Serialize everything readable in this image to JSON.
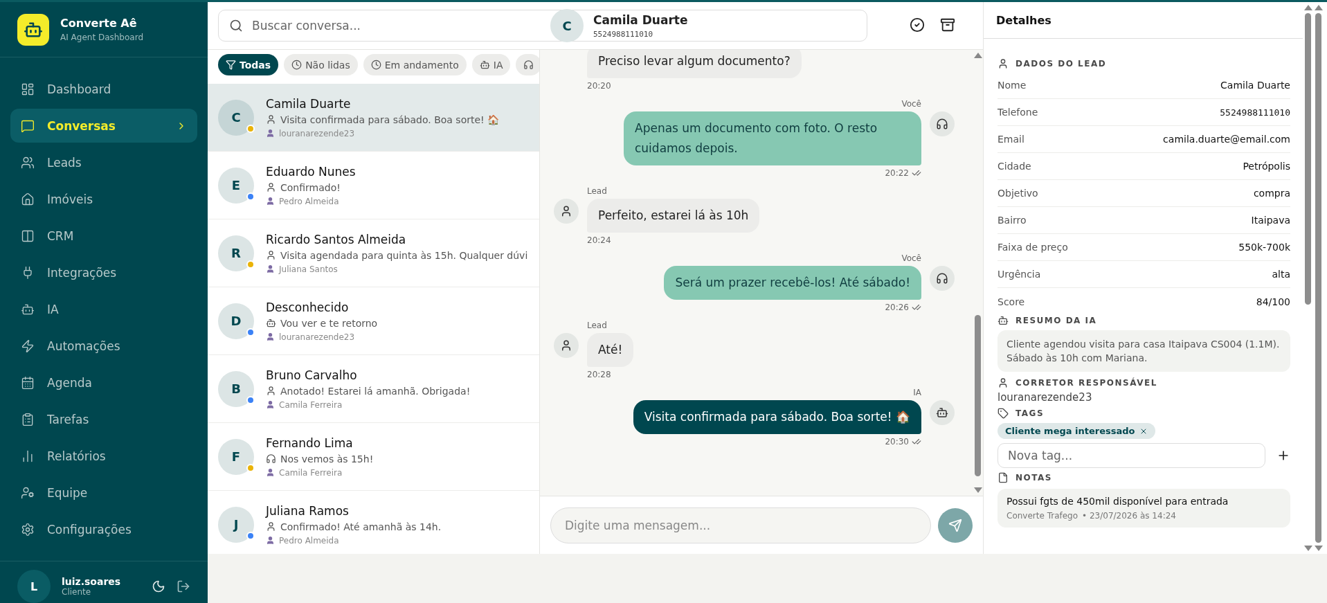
{
  "brand": {
    "name": "Converte Aê",
    "subtitle": "AI Agent Dashboard"
  },
  "nav": [
    {
      "label": "Dashboard",
      "selected": false
    },
    {
      "label": "Conversas",
      "selected": true
    },
    {
      "label": "Leads",
      "selected": false
    },
    {
      "label": "Imóveis",
      "selected": false
    },
    {
      "label": "CRM",
      "selected": false
    },
    {
      "label": "Integrações",
      "selected": false
    },
    {
      "label": "IA",
      "selected": false
    },
    {
      "label": "Automações",
      "selected": false
    },
    {
      "label": "Agenda",
      "selected": false
    },
    {
      "label": "Tarefas",
      "selected": false
    },
    {
      "label": "Relatórios",
      "selected": false
    },
    {
      "label": "Equipe",
      "selected": false
    },
    {
      "label": "Configurações",
      "selected": false
    }
  ],
  "user": {
    "initial": "L",
    "name": "luiz.soares",
    "role": "Cliente"
  },
  "search": {
    "placeholder": "Buscar conversa..."
  },
  "filters": [
    {
      "kind": "filter",
      "label": "Todas",
      "selected": true
    },
    {
      "kind": "clock",
      "label": "Não lidas",
      "selected": false
    },
    {
      "kind": "clock",
      "label": "Em andamento",
      "selected": false
    },
    {
      "kind": "bot",
      "label": "IA",
      "selected": false
    },
    {
      "kind": "headset",
      "selected": false
    }
  ],
  "conversations": [
    {
      "initial": "C",
      "name": "Camila Duarte",
      "kind": "person",
      "preview": "Visita confirmada para sábado. Boa sorte! 🏠",
      "assignee": "louranarezende23",
      "color": "#eab308",
      "selected": true
    },
    {
      "initial": "E",
      "name": "Eduardo Nunes",
      "kind": "person",
      "preview": "Confirmado!",
      "assignee": "Pedro Almeida",
      "color": "#3b82f6",
      "selected": false
    },
    {
      "initial": "R",
      "name": "Ricardo Santos Almeida",
      "kind": "person",
      "preview": "Visita agendada para quinta às 15h. Qualquer dúvi",
      "assignee": "Juliana Santos",
      "color": "#eab308",
      "selected": false
    },
    {
      "initial": "D",
      "name": "Desconhecido",
      "kind": "bot",
      "preview": "Vou ver e te retorno",
      "assignee": "louranarezende23",
      "color": "#3b82f6",
      "selected": false
    },
    {
      "initial": "B",
      "name": "Bruno Carvalho",
      "kind": "person",
      "preview": "Anotado! Estarei lá amanhã. Obrigada!",
      "assignee": "Camila Ferreira",
      "color": "#3b82f6",
      "selected": false
    },
    {
      "initial": "F",
      "name": "Fernando Lima",
      "kind": "headset",
      "preview": "Nos vemos às 15h!",
      "assignee": "Camila Ferreira",
      "color": "#eab308",
      "selected": false
    },
    {
      "initial": "J",
      "name": "Juliana Ramos",
      "kind": "person",
      "preview": "Confirmado! Até amanhã às 14h.",
      "assignee": "Pedro Almeida",
      "color": "#3b82f6",
      "selected": false
    }
  ],
  "chat": {
    "initial": "C",
    "name": "Camila Duarte",
    "phone": "5524988111010",
    "messages": [
      {
        "kind": "lead",
        "text": "Preciso levar algum documento?",
        "time": "20:20"
      },
      {
        "kind": "agent",
        "sender": "Você",
        "text": "Apenas um documento com foto. O resto cuidamos depois.",
        "time": "20:22"
      },
      {
        "kind": "lead",
        "sender": "Lead",
        "text": "Perfeito, estarei lá às 10h",
        "time": "20:24"
      },
      {
        "kind": "agent",
        "sender": "Você",
        "text": "Será um prazer recebê-los! Até sábado!",
        "time": "20:26"
      },
      {
        "kind": "lead",
        "sender": "Lead",
        "text": "Até!",
        "time": "20:28"
      },
      {
        "kind": "ia",
        "sender": "IA",
        "text": "Visita confirmada para sábado. Boa sorte! 🏠",
        "time": "20:30"
      }
    ],
    "input": {
      "placeholder": "Digite uma mensagem..."
    }
  },
  "details": {
    "title": "Detalhes",
    "lead_heading": "DADOS DO LEAD",
    "fields": [
      {
        "label": "Nome",
        "value": "Camila Duarte",
        "mono": false
      },
      {
        "label": "Telefone",
        "value": "5524988111010",
        "mono": true
      },
      {
        "label": "Email",
        "value": "camila.duarte@email.com",
        "mono": false
      },
      {
        "label": "Cidade",
        "value": "Petrópolis",
        "mono": false
      },
      {
        "label": "Objetivo",
        "value": "compra",
        "mono": false
      },
      {
        "label": "Bairro",
        "value": "Itaipava",
        "mono": false
      },
      {
        "label": "Faixa de preço",
        "value": "550k-700k",
        "mono": false
      },
      {
        "label": "Urgência",
        "value": "alta",
        "mono": false
      },
      {
        "label": "Score",
        "value": "84/100",
        "mono": false
      }
    ],
    "summary_heading": "RESUMO DA IA",
    "summary": "Cliente agendou visita para casa Itaipava CS004 (1.1M). Sábado às 10h com Mariana.",
    "broker_heading": "CORRETOR RESPONSÁVEL",
    "broker": "louranarezende23",
    "tags_heading": "TAGS",
    "tags": [
      "Cliente mega interessado"
    ],
    "tag_placeholder": "Nova tag...",
    "notes_heading": "NOTAS",
    "notes": [
      {
        "text": "Possui fgts de 450mil disponível para entrada",
        "author": "Converte Trafego",
        "date": "• 23/07/2026 às 14:24"
      }
    ]
  }
}
